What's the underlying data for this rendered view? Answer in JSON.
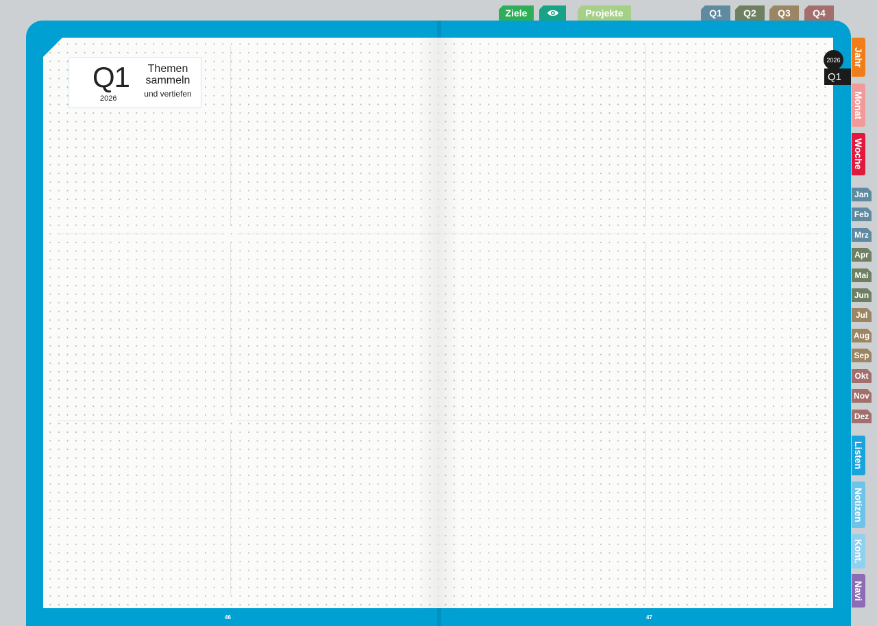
{
  "top_tabs": {
    "ziele": "Ziele",
    "eye_icon": "eye-icon",
    "projekte": "Projekte",
    "quarters": [
      "Q1",
      "Q2",
      "Q3",
      "Q4"
    ]
  },
  "page_left": {
    "quarter": "Q1",
    "year": "2026",
    "topic_line1": "Themen",
    "topic_line2": "sammeln",
    "topic_sub": "und vertiefen",
    "page_number": "46"
  },
  "page_right": {
    "page_number": "47"
  },
  "marker": {
    "year": "2026",
    "quarter": "Q1"
  },
  "side_tabs": [
    "Jahr",
    "Monat",
    "Woche"
  ],
  "month_tabs": [
    "Jan",
    "Feb",
    "Mrz",
    "Apr",
    "Mai",
    "Jun",
    "Jul",
    "Aug",
    "Sep",
    "Okt",
    "Nov",
    "Dez"
  ],
  "bottom_tabs": [
    "Listen",
    "Notizen",
    "Kont.",
    "Navi"
  ],
  "colors": {
    "cover": "#00a0d2",
    "jahr": "#f07d1a",
    "monat": "#f29a9a",
    "woche": "#e2183f",
    "listen": "#1aa3dc",
    "notizen": "#6cc4e8",
    "kont": "#8fd1ef",
    "navi": "#8e6bb5"
  }
}
